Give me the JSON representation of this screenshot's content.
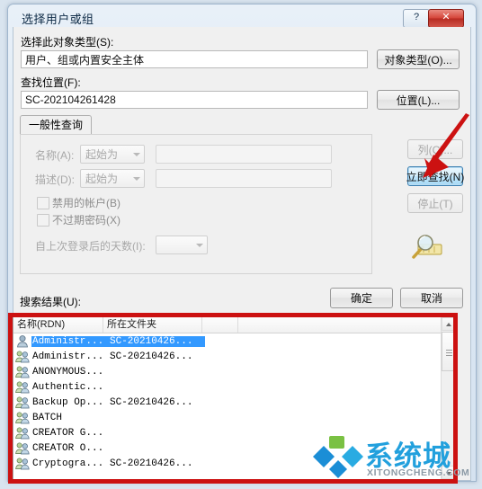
{
  "window": {
    "title": "选择用户或组",
    "help_button": "?",
    "close_button": "✕"
  },
  "object_type": {
    "label": "选择此对象类型(S):",
    "value": "用户、组或内置安全主体",
    "button": "对象类型(O)..."
  },
  "location": {
    "label": "查找位置(F):",
    "value": "SC-202104261428",
    "button": "位置(L)..."
  },
  "tabs": [
    {
      "label": "一般性查询",
      "active": true
    }
  ],
  "query": {
    "name": {
      "label": "名称(A):",
      "condition": "起始为",
      "value": ""
    },
    "description": {
      "label": "描述(D):",
      "condition": "起始为",
      "value": ""
    },
    "disabled_accounts": {
      "label": "禁用的帐户(B)",
      "checked": false
    },
    "non_expiring_password": {
      "label": "不过期密码(X)",
      "checked": false
    },
    "days_since_last_logon": {
      "label": "自上次登录后的天数(I):",
      "value": ""
    }
  },
  "side_buttons": {
    "columns": "列(C)...",
    "find_now": "立即查找(N)",
    "stop": "停止(T)"
  },
  "dialog_buttons": {
    "ok": "确定",
    "cancel": "取消"
  },
  "results": {
    "label": "搜索结果(U):",
    "columns": [
      "名称(RDN)",
      "所在文件夹"
    ],
    "rows": [
      {
        "name": "Administr...",
        "folder": "SC-20210426...",
        "icon": "user-icon",
        "selected": true
      },
      {
        "name": "Administr...",
        "folder": "SC-20210426...",
        "icon": "group-icon",
        "selected": false
      },
      {
        "name": "ANONYMOUS...",
        "folder": "",
        "icon": "group-icon",
        "selected": false
      },
      {
        "name": "Authentic...",
        "folder": "",
        "icon": "group-icon",
        "selected": false
      },
      {
        "name": "Backup Op...",
        "folder": "SC-20210426...",
        "icon": "group-icon",
        "selected": false
      },
      {
        "name": "BATCH",
        "folder": "",
        "icon": "group-icon",
        "selected": false
      },
      {
        "name": "CREATOR G...",
        "folder": "",
        "icon": "group-icon",
        "selected": false
      },
      {
        "name": "CREATOR O...",
        "folder": "",
        "icon": "group-icon",
        "selected": false
      },
      {
        "name": "Cryptogra...",
        "folder": "SC-20210426...",
        "icon": "group-icon",
        "selected": false
      }
    ]
  },
  "annotations": {
    "arrow_target": "立即查找(N)",
    "highlight_region": "搜索结果列表"
  },
  "watermark": {
    "cn": "系统城",
    "en": "XITONGCHENG.COM"
  },
  "colors": {
    "accent": "#3399ff",
    "annotation": "#cc1111",
    "close": "#d5453a",
    "watermark": "#22a0dd"
  }
}
